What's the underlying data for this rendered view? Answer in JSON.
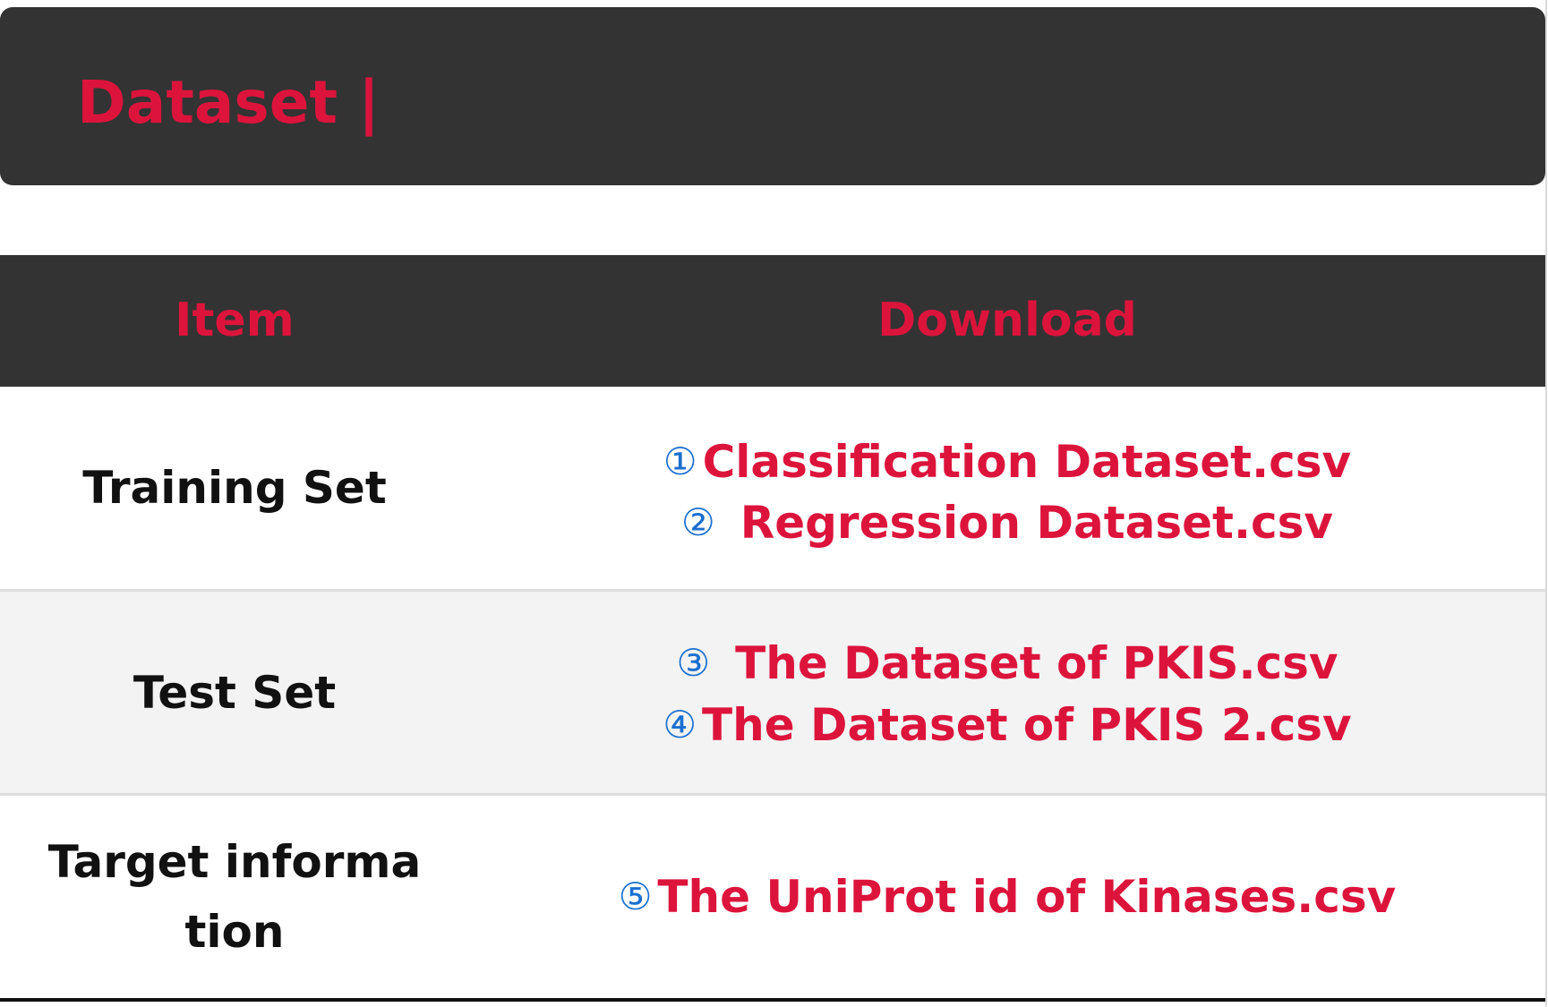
{
  "header": {
    "title": "Dataset |"
  },
  "table": {
    "columns": [
      "Item",
      "Download"
    ],
    "rows": [
      {
        "item": "Training Set",
        "downloads": [
          {
            "num": "①",
            "label": "Classification Dataset.csv"
          },
          {
            "num": "②",
            "label": "Regression Dataset.csv"
          }
        ]
      },
      {
        "item": "Test Set",
        "downloads": [
          {
            "num": "③",
            "label": "The Dataset of PKIS.csv"
          },
          {
            "num": "④",
            "label": "The Dataset of PKIS 2.csv"
          }
        ]
      },
      {
        "item": "Target information",
        "downloads": [
          {
            "num": "⑤",
            "label": "The UniProt id of Kinases.csv"
          }
        ]
      }
    ]
  },
  "colors": {
    "accent": "#dc143c",
    "header_bg": "#333333",
    "number_blue": "#1a6fd0",
    "alt_row_bg": "#f3f3f3"
  }
}
